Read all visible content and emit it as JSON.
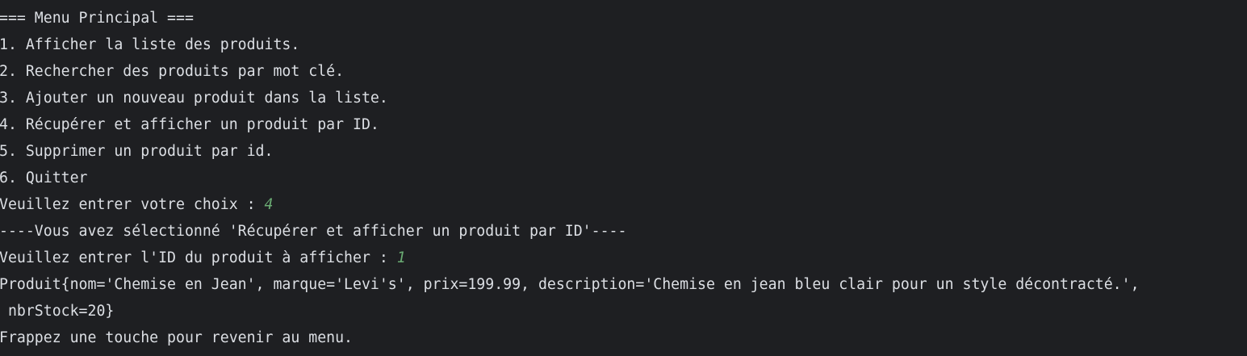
{
  "console": {
    "lines": [
      {
        "text": "=== Menu Principal ==="
      },
      {
        "text": "1. Afficher la liste des produits."
      },
      {
        "text": "2. Rechercher des produits par mot clé."
      },
      {
        "text": "3. Ajouter un nouveau produit dans la liste."
      },
      {
        "text": "4. Récupérer et afficher un produit par ID."
      },
      {
        "text": "5. Supprimer un produit par id."
      },
      {
        "text": "6. Quitter"
      },
      {
        "text": "Veuillez entrer votre choix : ",
        "input": "4"
      },
      {
        "text": "----Vous avez sélectionné 'Récupérer et afficher un produit par ID'----"
      },
      {
        "text": "Veuillez entrer l'ID du produit à afficher : ",
        "input": "1"
      },
      {
        "text": "Produit{nom='Chemise en Jean', marque='Levi's', prix=199.99, description='Chemise en jean bleu clair pour un style décontracté.',"
      },
      {
        "text": " nbrStock=20}"
      },
      {
        "text": "Frappez une touche pour revenir au menu."
      }
    ]
  },
  "colors": {
    "background": "#1e1f22",
    "text": "#dcdfe4",
    "user_input": "#6aab73"
  }
}
